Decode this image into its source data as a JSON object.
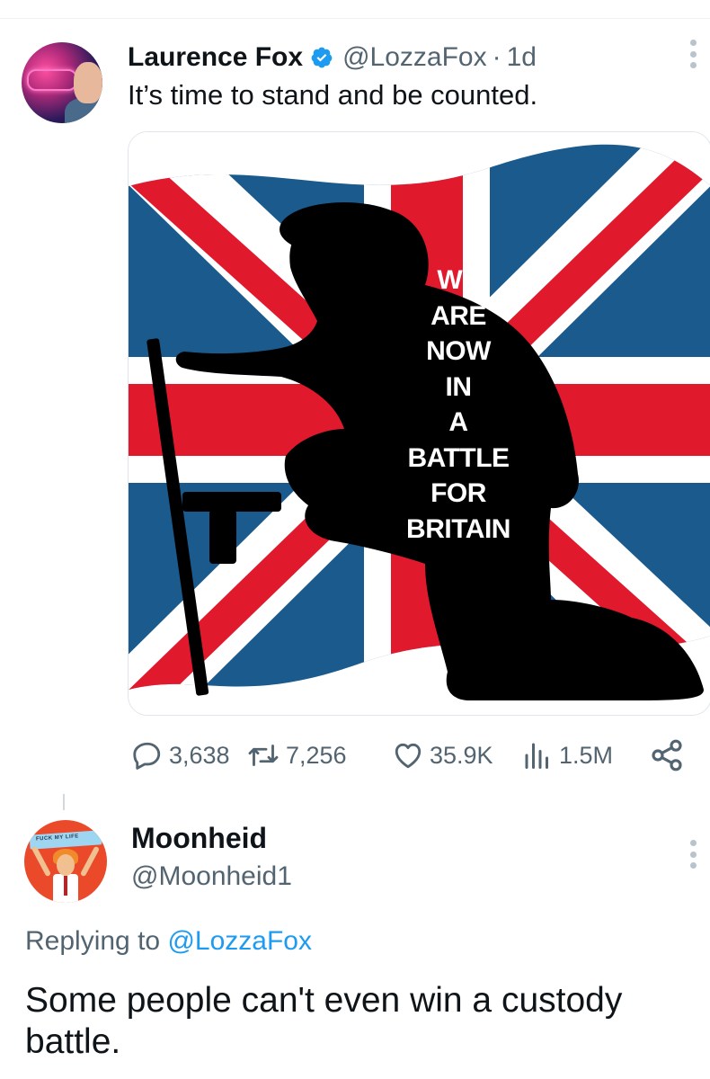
{
  "tweet": {
    "author_name": "Laurence Fox",
    "handle": "@LozzaFox",
    "separator": "·",
    "time": "1d",
    "text": "It’s time to stand and be counted.",
    "poster_lines": [
      "WE",
      "ARE",
      "NOW",
      "IN",
      "A",
      "BATTLE",
      "FOR",
      "BRITAIN"
    ],
    "stats": {
      "replies": "3,638",
      "retweets": "7,256",
      "likes": "35.9K",
      "views": "1.5M"
    }
  },
  "reply": {
    "author_name": "Moonheid",
    "handle": "@Moonheid1",
    "avatar_banner_text": "FUCK MY LIFE",
    "replying_prefix": "Replying to",
    "replying_mention": "@LozzaFox",
    "text": "Some people can't even win a custody battle."
  },
  "colors": {
    "verified_blue": "#1d9bf0",
    "text_primary": "#0f1419",
    "text_secondary": "#536471",
    "flag_red": "#e0192d",
    "flag_blue": "#1a5a8c"
  },
  "icons": [
    "verified-badge-icon",
    "more-icon",
    "reply-icon",
    "retweet-icon",
    "like-icon",
    "views-icon",
    "share-icon"
  ]
}
